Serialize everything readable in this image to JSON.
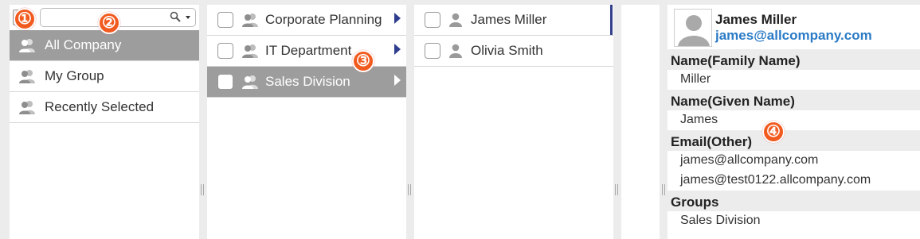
{
  "group_pane": {
    "search": {
      "value": "",
      "placeholder": ""
    },
    "items": [
      {
        "label": "All Company",
        "selected": true
      },
      {
        "label": "My Group",
        "selected": false
      },
      {
        "label": "Recently Selected",
        "selected": false
      }
    ]
  },
  "division_pane": {
    "items": [
      {
        "label": "Corporate Planning",
        "selected": false
      },
      {
        "label": "IT Department",
        "selected": false
      },
      {
        "label": "Sales Division",
        "selected": true
      }
    ]
  },
  "member_pane": {
    "items": [
      {
        "label": "James Miller"
      },
      {
        "label": "Olivia Smith"
      }
    ]
  },
  "detail": {
    "name": "James Miller",
    "email": "james@allcompany.com",
    "sections": {
      "family_name": {
        "title": "Name(Family Name)",
        "value": "Miller"
      },
      "given_name": {
        "title": "Name(Given Name)",
        "value": "James"
      },
      "email_other": {
        "title": "Email(Other)",
        "values": [
          "james@allcompany.com",
          "james@test0122.allcompany.com"
        ]
      },
      "groups": {
        "title": "Groups",
        "value": "Sales Division"
      }
    }
  },
  "callouts": [
    "①",
    "②",
    "③",
    "④"
  ],
  "colors": {
    "selected_row": "#9d9d9d",
    "arrow": "#2f3d8f",
    "link": "#2b7bc6",
    "callout": "#f25b1f"
  }
}
